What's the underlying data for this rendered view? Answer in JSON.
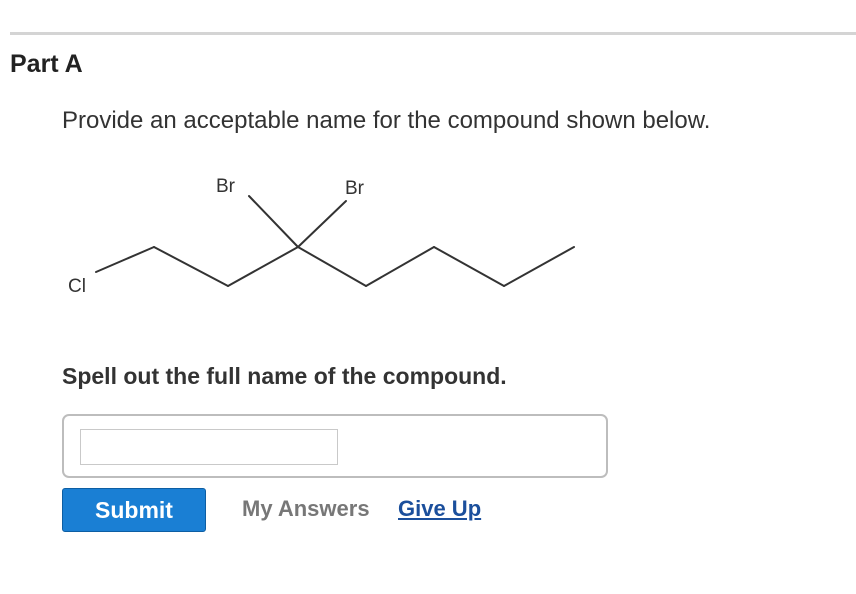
{
  "part": {
    "title": "Part A"
  },
  "question": {
    "prompt": "Provide an acceptable name for the compound shown below."
  },
  "structure": {
    "atom_labels": {
      "bromine_left": "Br",
      "bromine_right": "Br",
      "chlorine": "Cl"
    },
    "bond_color": "#333333"
  },
  "answer": {
    "instruction": "Spell out the full name of the compound.",
    "input_value": "",
    "input_placeholder": ""
  },
  "actions": {
    "submit_label": "Submit",
    "my_answers_label": "My Answers",
    "give_up_label": "Give Up"
  },
  "colors": {
    "submit_bg": "#1a7fd4",
    "link": "#1b4f9c",
    "muted": "#777777"
  }
}
